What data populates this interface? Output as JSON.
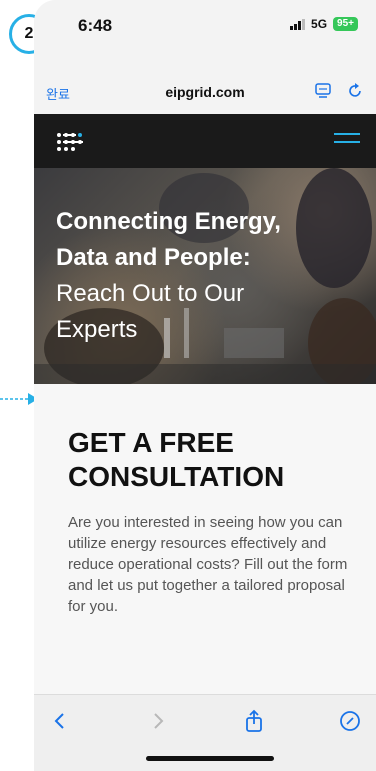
{
  "annotation": {
    "step_number": "2"
  },
  "status_bar": {
    "time": "6:48",
    "network": "5G",
    "battery": "95+"
  },
  "browser": {
    "done_label": "완료",
    "url": "eipgrid.com",
    "reader_icon": "reader-mode-icon",
    "reload_icon": "reload-icon"
  },
  "site_nav": {
    "logo_icon": "eipgrid-logo",
    "menu_icon": "hamburger-menu-icon",
    "accent_color": "#27b0e6"
  },
  "hero": {
    "line1": "Connecting Energy,",
    "line2": "Data and People:",
    "line3": "Reach Out to Our",
    "line4": "Experts"
  },
  "consultation": {
    "heading_line1": "GET A FREE",
    "heading_line2": "CONSULTATION",
    "description": "Are you interested in seeing how you can utilize energy resources effectively and reduce operational costs? Fill out the form and let us put together a tailored proposal for you."
  },
  "toolbar": {
    "back_icon": "chevron-left-icon",
    "forward_icon": "chevron-right-icon",
    "share_icon": "share-icon",
    "compass_icon": "compass-icon",
    "icon_color": "#1a73e8"
  }
}
